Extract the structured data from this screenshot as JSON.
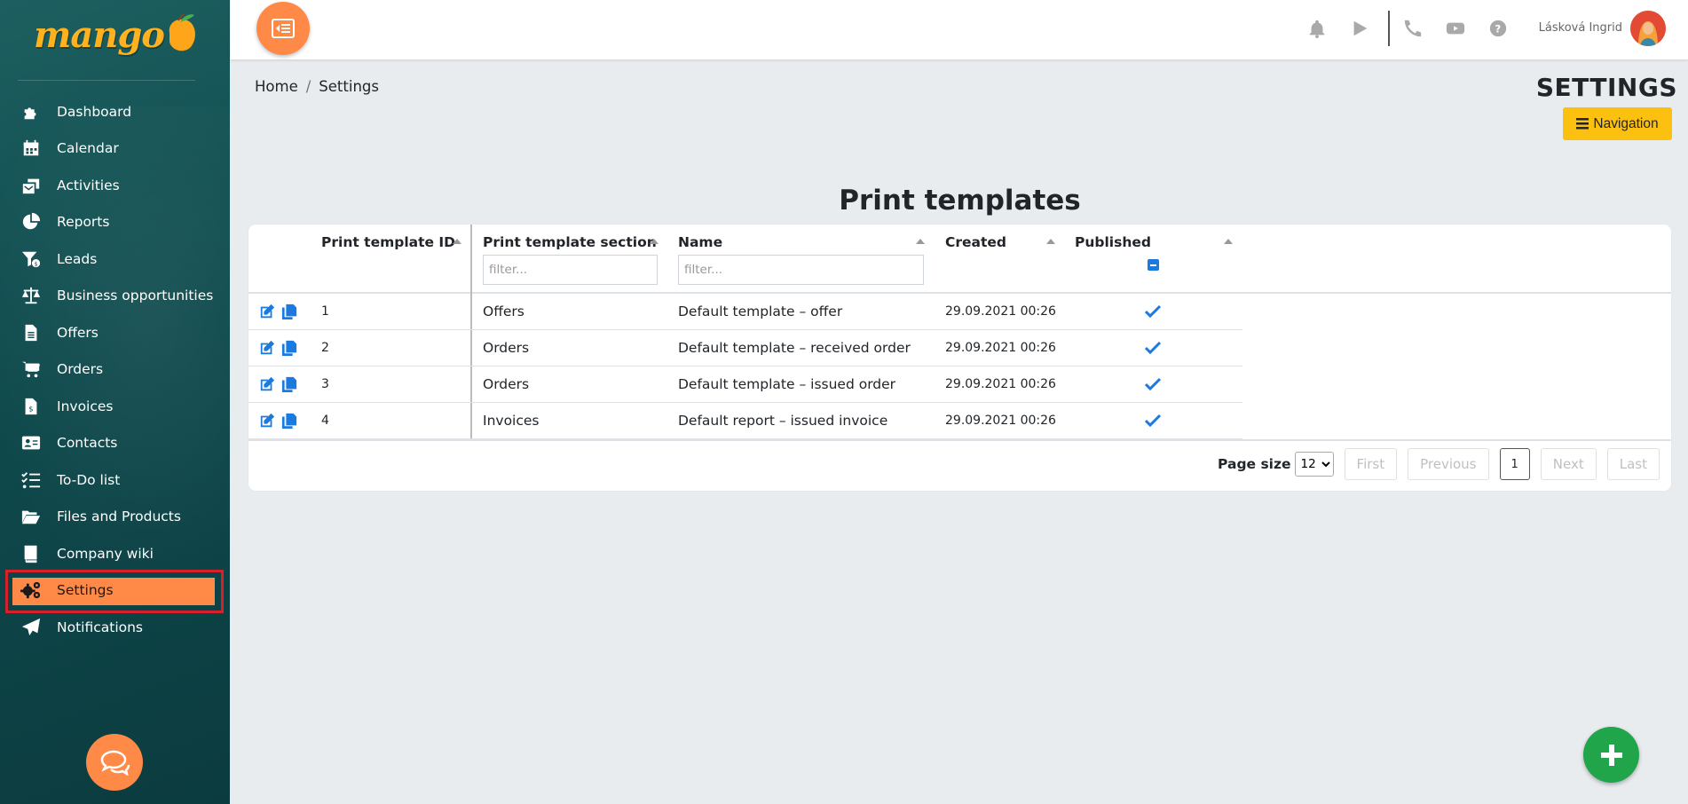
{
  "app": {
    "logo_text": "mango"
  },
  "sidebar": {
    "items": [
      {
        "label": "Dashboard",
        "icon": "puzzle-icon"
      },
      {
        "label": "Calendar",
        "icon": "calendar-icon"
      },
      {
        "label": "Activities",
        "icon": "activities-icon"
      },
      {
        "label": "Reports",
        "icon": "pie-chart-icon"
      },
      {
        "label": "Leads",
        "icon": "funnel-dollar-icon"
      },
      {
        "label": "Business opportunities",
        "icon": "scales-icon"
      },
      {
        "label": "Offers",
        "icon": "file-icon"
      },
      {
        "label": "Orders",
        "icon": "cart-icon"
      },
      {
        "label": "Invoices",
        "icon": "invoice-icon"
      },
      {
        "label": "Contacts",
        "icon": "address-card-icon"
      },
      {
        "label": "To-Do list",
        "icon": "tasks-icon"
      },
      {
        "label": "Files and Products",
        "icon": "folder-open-icon"
      },
      {
        "label": "Company wiki",
        "icon": "book-icon"
      },
      {
        "label": "Settings",
        "icon": "cogs-icon",
        "active": true
      },
      {
        "label": "Notifications",
        "icon": "paper-plane-icon"
      }
    ]
  },
  "header": {
    "user_name": "Lásková Ingrid",
    "icons": [
      "bell-icon",
      "play-icon",
      "phone-icon",
      "youtube-icon",
      "question-icon"
    ]
  },
  "breadcrumb": {
    "home": "Home",
    "separator": "/",
    "current": "Settings"
  },
  "page": {
    "heading": "SETTINGS",
    "navigation_button": "Navigation"
  },
  "grid": {
    "title": "Print templates",
    "columns": {
      "id": "Print template ID",
      "section": "Print template section",
      "name": "Name",
      "created": "Created",
      "published": "Published"
    },
    "filter_placeholder": "filter...",
    "rows": [
      {
        "id": "1",
        "section": "Offers",
        "name": "Default template – offer",
        "created": "29.09.2021 00:26",
        "published": true
      },
      {
        "id": "2",
        "section": "Orders",
        "name": "Default template – received order",
        "created": "29.09.2021 00:26",
        "published": true
      },
      {
        "id": "3",
        "section": "Orders",
        "name": "Default template – issued order",
        "created": "29.09.2021 00:26",
        "published": true
      },
      {
        "id": "4",
        "section": "Invoices",
        "name": "Default report – issued invoice",
        "created": "29.09.2021 00:26",
        "published": true
      }
    ],
    "pager": {
      "page_size_label": "Page size",
      "page_size": "12",
      "first": "First",
      "previous": "Previous",
      "current_page": "1",
      "next": "Next",
      "last": "Last"
    }
  },
  "colors": {
    "accent": "#ff8a48",
    "sidebar": "#0f4a4d",
    "active_outline": "#d6202a",
    "nav_button": "#fcc010",
    "add_button": "#21a54a",
    "link_blue": "#1a7ae0"
  }
}
